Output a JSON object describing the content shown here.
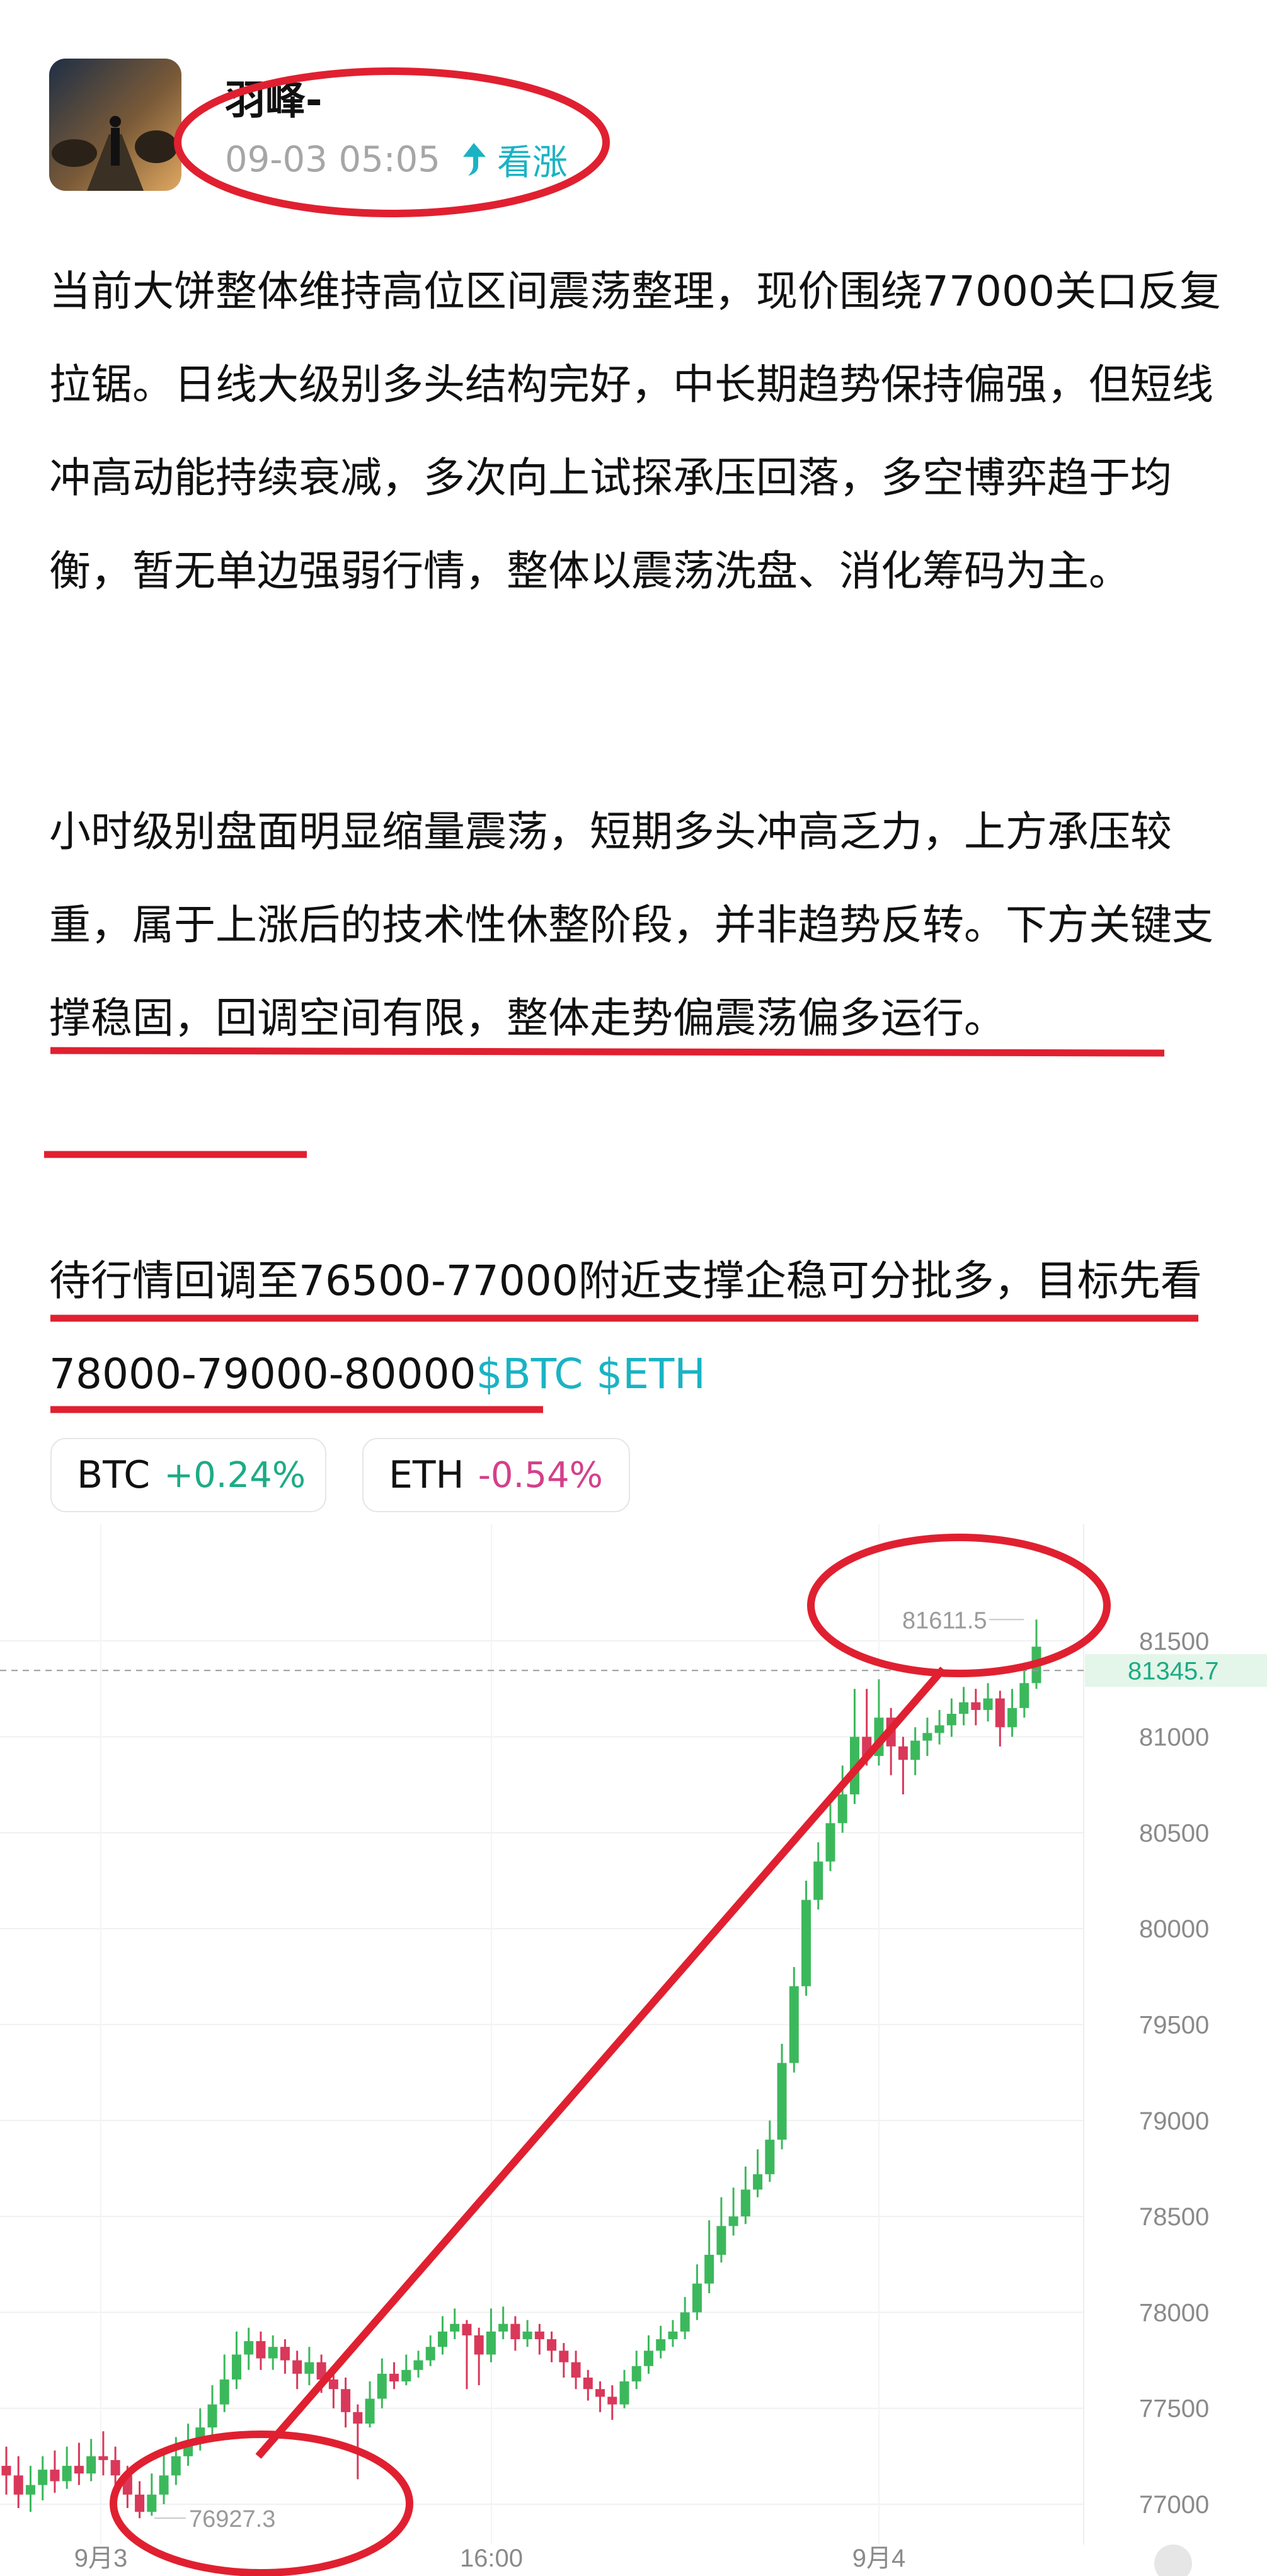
{
  "post": {
    "author": "羽峰-",
    "time": "09-03 05:05",
    "sentiment": "看涨",
    "paragraphs": [
      "当前大饼整体维持高位区间震荡整理，现价围绕77000关口反复拉锯。日线大级别多头结构完好，中长期趋势保持偏强，但短线冲高动能持续衰减，多次向上试探承压回落，多空博弈趋于均衡，暂无单边强弱行情，整体以震荡洗盘、消化筹码为主。",
      "小时级别盘面明显缩量震荡，短期多头冲高乏力，上方承压较重，属于上涨后的技术性休整阶段，并非趋势反转。下方关键支撑稳固，回调空间有限，整体走势偏震荡偏多运行。",
      "待行情回调至76500-77000附近支撑企稳可分批多，目标先看78000-79000-80000"
    ],
    "tickers": "$BTC $ETH"
  },
  "chips": [
    {
      "symbol": "BTC",
      "change": "+0.24%"
    },
    {
      "symbol": "ETH",
      "change": "-0.54%"
    }
  ],
  "colors": {
    "up": "#1dab86",
    "down": "#d4408a",
    "accent": "#1ab3c4",
    "candle_up": "#3cb85c",
    "candle_down": "#d9385a",
    "annotation": "#e02030"
  },
  "chart_data": {
    "type": "candlestick",
    "y_ticks": [
      77000,
      77500,
      78000,
      78500,
      79000,
      79500,
      80000,
      80500,
      81000,
      81500
    ],
    "x_ticks": [
      "9月3",
      "16:00",
      "9月4"
    ],
    "ylim": [
      76800,
      81800
    ],
    "current_price": "81345.7",
    "high_label": "81611.5",
    "low_label": "76927.3",
    "candles": [
      [
        77200,
        77150,
        77300,
        77050
      ],
      [
        77150,
        77050,
        77250,
        76980
      ],
      [
        77050,
        77100,
        77200,
        76960
      ],
      [
        77100,
        77180,
        77250,
        77020
      ],
      [
        77180,
        77120,
        77280,
        77060
      ],
      [
        77120,
        77200,
        77300,
        77080
      ],
      [
        77200,
        77160,
        77320,
        77100
      ],
      [
        77160,
        77250,
        77340,
        77120
      ],
      [
        77250,
        77230,
        77380,
        77150
      ],
      [
        77230,
        77150,
        77300,
        77050
      ],
      [
        77150,
        77050,
        77200,
        76980
      ],
      [
        77050,
        76960,
        77120,
        76927
      ],
      [
        76960,
        77050,
        77160,
        76940
      ],
      [
        77050,
        77150,
        77260,
        77000
      ],
      [
        77150,
        77250,
        77350,
        77100
      ],
      [
        77250,
        77330,
        77420,
        77200
      ],
      [
        77330,
        77400,
        77500,
        77280
      ],
      [
        77400,
        77520,
        77620,
        77360
      ],
      [
        77520,
        77650,
        77780,
        77480
      ],
      [
        77650,
        77780,
        77900,
        77600
      ],
      [
        77780,
        77850,
        77920,
        77700
      ],
      [
        77850,
        77760,
        77900,
        77700
      ],
      [
        77760,
        77820,
        77880,
        77700
      ],
      [
        77820,
        77750,
        77860,
        77680
      ],
      [
        77750,
        77680,
        77800,
        77600
      ],
      [
        77680,
        77740,
        77820,
        77620
      ],
      [
        77740,
        77650,
        77780,
        77580
      ],
      [
        77650,
        77600,
        77720,
        77500
      ],
      [
        77600,
        77480,
        77660,
        77400
      ],
      [
        77480,
        77420,
        77520,
        77130
      ],
      [
        77420,
        77550,
        77640,
        77400
      ],
      [
        77550,
        77680,
        77760,
        77500
      ],
      [
        77680,
        77640,
        77740,
        77600
      ],
      [
        77640,
        77700,
        77780,
        77620
      ],
      [
        77700,
        77750,
        77800,
        77660
      ],
      [
        77750,
        77820,
        77880,
        77720
      ],
      [
        77820,
        77900,
        77980,
        77780
      ],
      [
        77900,
        77940,
        78020,
        77860
      ],
      [
        77940,
        77880,
        77960,
        77600
      ],
      [
        77880,
        77780,
        77920,
        77620
      ],
      [
        77780,
        77900,
        78020,
        77740
      ],
      [
        77900,
        77940,
        78030,
        77860
      ],
      [
        77940,
        77860,
        77980,
        77800
      ],
      [
        77860,
        77900,
        77960,
        77820
      ],
      [
        77900,
        77860,
        77940,
        77780
      ],
      [
        77860,
        77800,
        77900,
        77740
      ],
      [
        77800,
        77740,
        77840,
        77660
      ],
      [
        77740,
        77660,
        77800,
        77600
      ],
      [
        77660,
        77600,
        77700,
        77540
      ],
      [
        77600,
        77560,
        77640,
        77480
      ],
      [
        77560,
        77520,
        77620,
        77440
      ],
      [
        77520,
        77640,
        77700,
        77500
      ],
      [
        77640,
        77720,
        77800,
        77600
      ],
      [
        77720,
        77800,
        77880,
        77680
      ],
      [
        77800,
        77860,
        77930,
        77760
      ],
      [
        77860,
        77900,
        77960,
        77820
      ],
      [
        77900,
        78000,
        78080,
        77860
      ],
      [
        78000,
        78150,
        78250,
        77960
      ],
      [
        78150,
        78300,
        78480,
        78100
      ],
      [
        78300,
        78450,
        78600,
        78260
      ],
      [
        78450,
        78500,
        78650,
        78400
      ],
      [
        78500,
        78640,
        78760,
        78460
      ],
      [
        78640,
        78720,
        78850,
        78600
      ],
      [
        78720,
        78900,
        79000,
        78680
      ],
      [
        78900,
        79300,
        79400,
        78850
      ],
      [
        79300,
        79700,
        79800,
        79250
      ],
      [
        79700,
        80150,
        80250,
        79650
      ],
      [
        80150,
        80350,
        80450,
        80100
      ],
      [
        80350,
        80550,
        80650,
        80300
      ],
      [
        80550,
        80700,
        80850,
        80500
      ],
      [
        80700,
        81000,
        81250,
        80650
      ],
      [
        81000,
        80900,
        81250,
        80850
      ],
      [
        80900,
        81100,
        81300,
        80850
      ],
      [
        81100,
        80950,
        81150,
        80800
      ],
      [
        80950,
        80880,
        81000,
        80700
      ],
      [
        80880,
        80980,
        81050,
        80800
      ],
      [
        80980,
        81020,
        81100,
        80900
      ],
      [
        81020,
        81060,
        81140,
        80960
      ],
      [
        81060,
        81120,
        81200,
        81000
      ],
      [
        81120,
        81180,
        81260,
        81060
      ],
      [
        81180,
        81140,
        81250,
        81060
      ],
      [
        81140,
        81200,
        81280,
        81080
      ],
      [
        81200,
        81050,
        81240,
        80950
      ],
      [
        81050,
        81150,
        81250,
        81000
      ],
      [
        81150,
        81280,
        81380,
        81100
      ],
      [
        81280,
        81470,
        81611.5,
        81250
      ]
    ]
  }
}
